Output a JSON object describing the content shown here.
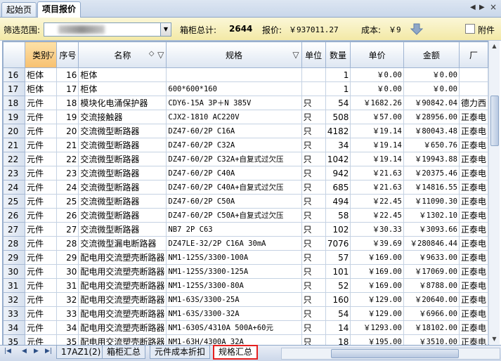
{
  "tabs": [
    {
      "label": "起始页",
      "active": false
    },
    {
      "label": "项目报价",
      "active": true
    }
  ],
  "filter": {
    "range_label": "筛选范围:",
    "box_total_label": "箱柜总计:",
    "box_total_value": "2644",
    "quote_label": "报价:",
    "quote_value": "￥937011.27",
    "cost_label": "成本:",
    "cost_value": "￥9",
    "attachment_label": "附件"
  },
  "columns": [
    "",
    "类别",
    "序号",
    "名称",
    "规格",
    "单位",
    "数量",
    "单价",
    "金额",
    "厂"
  ],
  "rows": [
    [
      "16",
      "柜体",
      "16",
      "柜体",
      "",
      "",
      "1",
      "￥0.00",
      "￥0.00",
      ""
    ],
    [
      "17",
      "柜体",
      "17",
      "柜体",
      "600*600*160",
      "",
      "1",
      "￥0.00",
      "￥0.00",
      ""
    ],
    [
      "18",
      "元件",
      "18",
      "模块化电涌保护器",
      "CDY6-15A 3P＋N 385V",
      "只",
      "54",
      "￥1682.26",
      "￥90842.04",
      "德力西"
    ],
    [
      "19",
      "元件",
      "19",
      "交流接触器",
      "CJX2-1810 AC220V",
      "只",
      "508",
      "￥57.00",
      "￥28956.00",
      "正泰电"
    ],
    [
      "20",
      "元件",
      "20",
      "交流微型断路器",
      "DZ47-60/2P C16A",
      "只",
      "4182",
      "￥19.14",
      "￥80043.48",
      "正泰电"
    ],
    [
      "21",
      "元件",
      "21",
      "交流微型断路器",
      "DZ47-60/2P C32A",
      "只",
      "34",
      "￥19.14",
      "￥650.76",
      "正泰电"
    ],
    [
      "22",
      "元件",
      "22",
      "交流微型断路器",
      "DZ47-60/2P C32A+自复式过欠压",
      "只",
      "1042",
      "￥19.14",
      "￥19943.88",
      "正泰电"
    ],
    [
      "23",
      "元件",
      "23",
      "交流微型断路器",
      "DZ47-60/2P C40A",
      "只",
      "942",
      "￥21.63",
      "￥20375.46",
      "正泰电"
    ],
    [
      "24",
      "元件",
      "24",
      "交流微型断路器",
      "DZ47-60/2P C40A+自复式过欠压",
      "只",
      "685",
      "￥21.63",
      "￥14816.55",
      "正泰电"
    ],
    [
      "25",
      "元件",
      "25",
      "交流微型断路器",
      "DZ47-60/2P C50A",
      "只",
      "494",
      "￥22.45",
      "￥11090.30",
      "正泰电"
    ],
    [
      "26",
      "元件",
      "26",
      "交流微型断路器",
      "DZ47-60/2P C50A+自复式过欠压",
      "只",
      "58",
      "￥22.45",
      "￥1302.10",
      "正泰电"
    ],
    [
      "27",
      "元件",
      "27",
      "交流微型断路器",
      "NB7 2P C63",
      "只",
      "102",
      "￥30.33",
      "￥3093.66",
      "正泰电"
    ],
    [
      "28",
      "元件",
      "28",
      "交流微型漏电断路器",
      "DZ47LE-32/2P C16A 30mA",
      "只",
      "7076",
      "￥39.69",
      "￥280846.44",
      "正泰电"
    ],
    [
      "29",
      "元件",
      "29",
      "配电用交流塑壳断路器",
      "NM1-125S/3300-100A",
      "只",
      "57",
      "￥169.00",
      "￥9633.00",
      "正泰电"
    ],
    [
      "30",
      "元件",
      "30",
      "配电用交流塑壳断路器",
      "NM1-125S/3300-125A",
      "只",
      "101",
      "￥169.00",
      "￥17069.00",
      "正泰电"
    ],
    [
      "31",
      "元件",
      "31",
      "配电用交流塑壳断路器",
      "NM1-125S/3300-80A",
      "只",
      "52",
      "￥169.00",
      "￥8788.00",
      "正泰电"
    ],
    [
      "32",
      "元件",
      "32",
      "配电用交流塑壳断路器",
      "NM1-63S/3300-25A",
      "只",
      "160",
      "￥129.00",
      "￥20640.00",
      "正泰电"
    ],
    [
      "33",
      "元件",
      "33",
      "配电用交流塑壳断路器",
      "NM1-63S/3300-32A",
      "只",
      "54",
      "￥129.00",
      "￥6966.00",
      "正泰电"
    ],
    [
      "34",
      "元件",
      "34",
      "配电用交流塑壳断路器",
      "NM1-630S/4310A 500A+60元",
      "只",
      "14",
      "￥1293.00",
      "￥18102.00",
      "正泰电"
    ],
    [
      "35",
      "元件",
      "35",
      "配电用交流塑壳断路器",
      "NM1-63H/4300A 32A",
      "只",
      "18",
      "￥195.00",
      "￥3510.00",
      "正泰电"
    ]
  ],
  "sheet_tabs": [
    {
      "label": "17AZ1(2)",
      "active": false
    },
    {
      "label": "箱柜汇总",
      "active": false
    },
    {
      "label": "元件成本折扣",
      "active": false
    },
    {
      "label": "规格汇总",
      "active": true
    }
  ],
  "colors": {
    "accent": "#f7c070",
    "highlight_border": "#e52020",
    "filter_bg": "#f3e9a6"
  }
}
